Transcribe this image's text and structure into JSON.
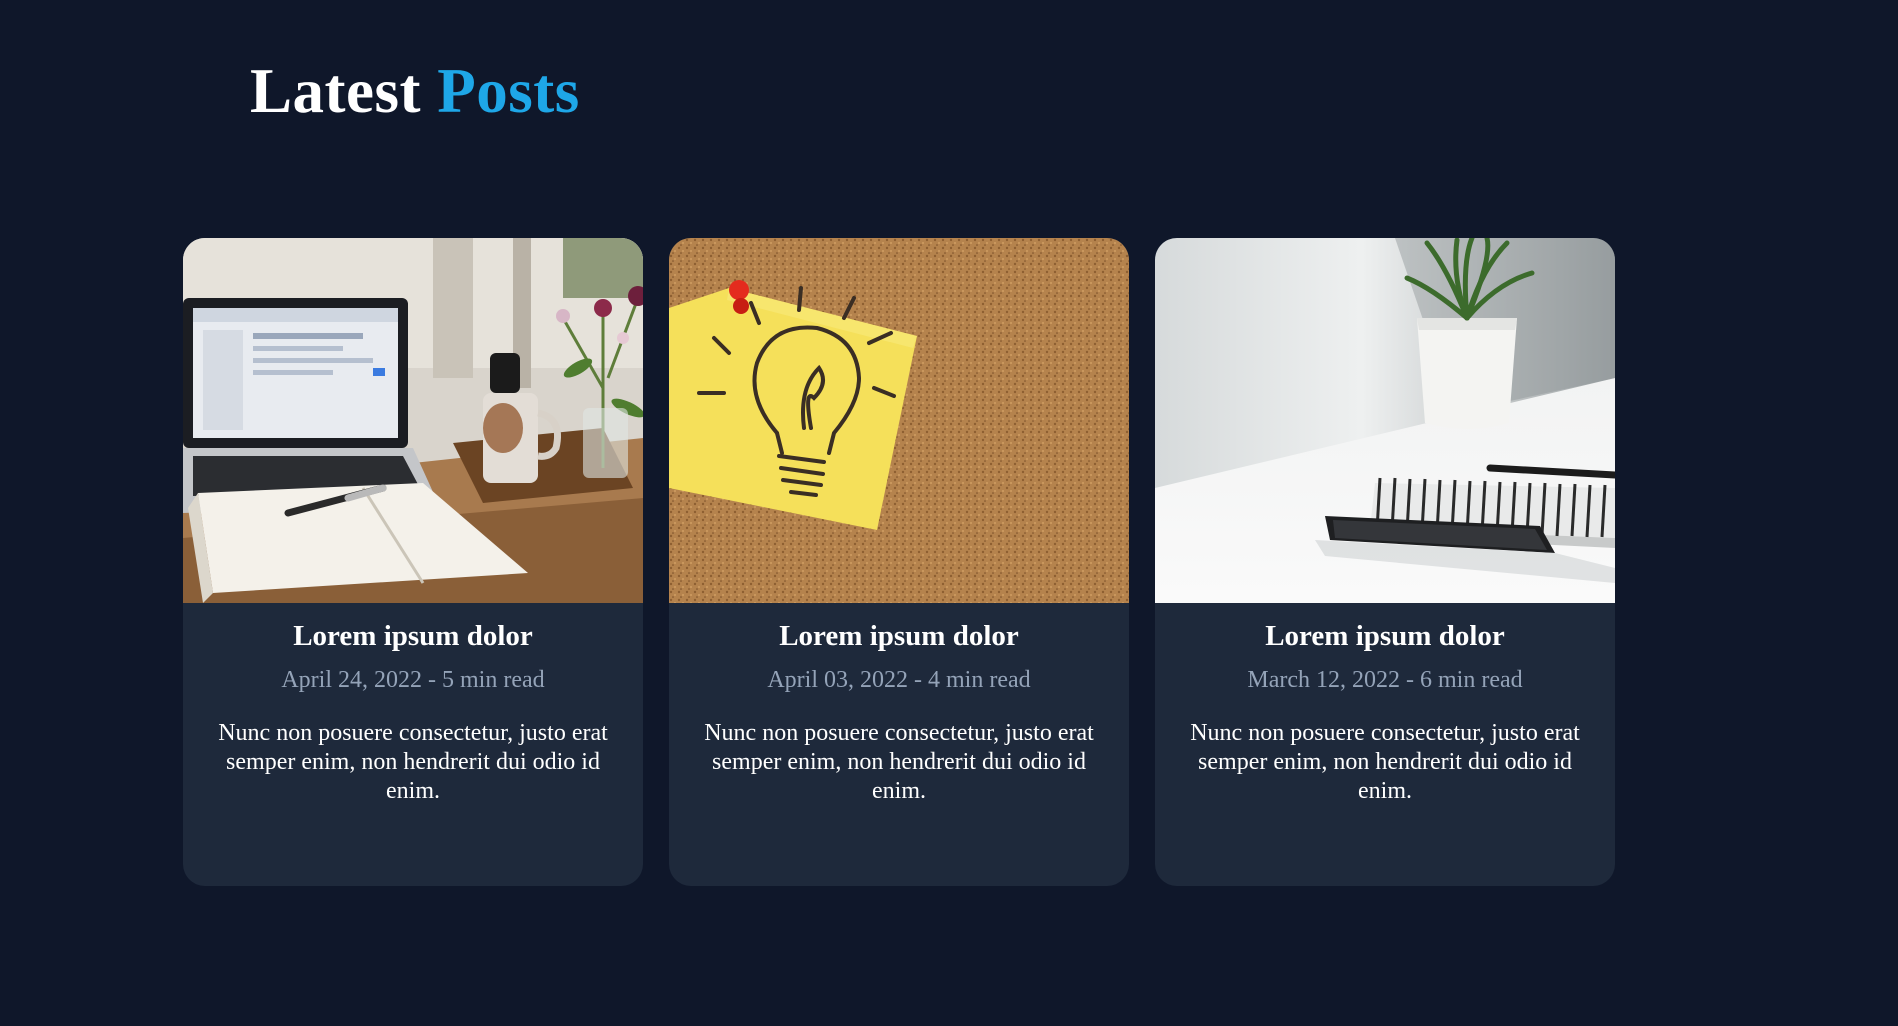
{
  "header": {
    "title_part1": "Latest",
    "title_part2": "Posts",
    "accent_color": "#1ea7e8"
  },
  "posts": [
    {
      "image": "laptop-notebook-photo",
      "title": "Lorem ipsum dolor",
      "meta": "April 24, 2022 - 5 min read",
      "excerpt": "Nunc non posuere consectetur, justo erat semper enim, non hendrerit dui odio id enim."
    },
    {
      "image": "lightbulb-sticky-note-photo",
      "title": "Lorem ipsum dolor",
      "meta": "April 03, 2022 - 4 min read",
      "excerpt": "Nunc non posuere consectetur, justo erat semper enim, non hendrerit dui odio id enim."
    },
    {
      "image": "plant-notebook-phone-photo",
      "title": "Lorem ipsum dolor",
      "meta": "March 12, 2022 - 6 min read",
      "excerpt": "Nunc non posuere consectetur, justo erat semper enim, non hendrerit dui odio id enim."
    }
  ],
  "colors": {
    "background": "#0f172a",
    "card": "#1e293b",
    "meta_text": "#94a3b8"
  }
}
